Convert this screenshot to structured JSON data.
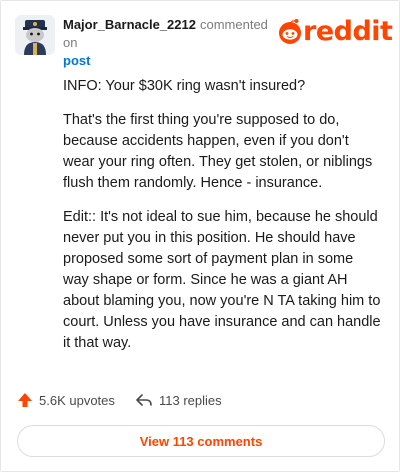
{
  "header": {
    "username": "Major_Barnacle_2212",
    "action_text": "commented on",
    "post_link": "post",
    "logo_text": "reddit"
  },
  "comment": {
    "paragraphs": [
      "INFO: Your $30K ring wasn't insured?",
      "That's the first thing you're supposed to do, because accidents happen, even if you don't wear your ring often. They get stolen, or niblings flush them randomly. Hence - insurance.",
      "Edit:: It's not ideal to sue him, because he should never put you in this position. He should have proposed some sort of payment plan in some way shape or form. Since he was a giant AH about blaming you, now you're N TA taking him to court. Unless you have insurance and can handle it that way."
    ]
  },
  "actions": {
    "upvotes": "5.6K upvotes",
    "replies": "113 replies",
    "view_comments": "View 113 comments"
  },
  "colors": {
    "brand": "#ff4500",
    "link": "#0079d3"
  },
  "icons": {
    "upvote": "upvote-arrow-icon",
    "reply": "reply-arrow-icon",
    "logo": "reddit-snoo-icon",
    "avatar": "snoo-avatar-icon"
  }
}
